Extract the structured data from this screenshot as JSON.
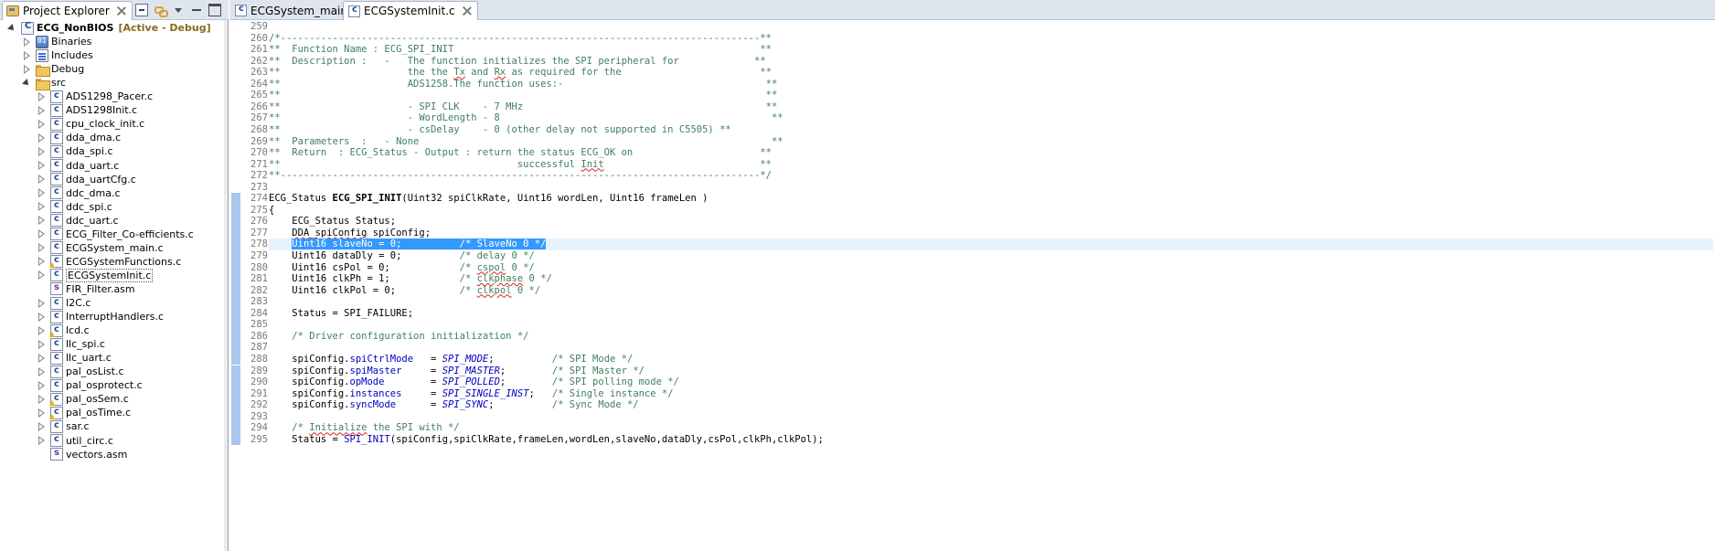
{
  "explorer": {
    "tab_label": "Project Explorer",
    "tree": [
      {
        "label": "ECG_NonBIOS",
        "decoration": "[Active - Debug]",
        "icon": "c-project-icon",
        "level": 0,
        "state": "open",
        "bold": true
      },
      {
        "label": "Binaries",
        "icon": "binaries-icon",
        "level": 1,
        "state": "closed"
      },
      {
        "label": "Includes",
        "icon": "includes-icon",
        "level": 1,
        "state": "closed"
      },
      {
        "label": "Debug",
        "icon": "folder-icon",
        "level": 1,
        "state": "closed"
      },
      {
        "label": "src",
        "icon": "source-folder-icon",
        "level": 1,
        "state": "open"
      },
      {
        "label": "ADS1298_Pacer.c",
        "icon": "c-file-icon",
        "level": 2,
        "state": "closed"
      },
      {
        "label": "ADS1298Init.c",
        "icon": "c-file-icon",
        "level": 2,
        "state": "closed"
      },
      {
        "label": "cpu_clock_init.c",
        "icon": "c-file-icon",
        "level": 2,
        "state": "closed"
      },
      {
        "label": "dda_dma.c",
        "icon": "c-file-icon",
        "level": 2,
        "state": "closed"
      },
      {
        "label": "dda_spi.c",
        "icon": "c-file-icon",
        "level": 2,
        "state": "closed"
      },
      {
        "label": "dda_uart.c",
        "icon": "c-file-icon",
        "level": 2,
        "state": "closed"
      },
      {
        "label": "dda_uartCfg.c",
        "icon": "c-file-icon",
        "level": 2,
        "state": "closed"
      },
      {
        "label": "ddc_dma.c",
        "icon": "c-file-icon",
        "level": 2,
        "state": "closed"
      },
      {
        "label": "ddc_spi.c",
        "icon": "c-file-icon",
        "level": 2,
        "state": "closed"
      },
      {
        "label": "ddc_uart.c",
        "icon": "c-file-icon",
        "level": 2,
        "state": "closed"
      },
      {
        "label": "ECG_Filter_Co-efficients.c",
        "icon": "c-file-icon",
        "level": 2,
        "state": "closed"
      },
      {
        "label": "ECGSystem_main.c",
        "icon": "c-file-icon",
        "level": 2,
        "state": "closed"
      },
      {
        "label": "ECGSystemFunctions.c",
        "icon": "c-file-warning-icon",
        "level": 2,
        "state": "closed"
      },
      {
        "label": "ECGSystemInit.c",
        "icon": "c-file-icon",
        "level": 2,
        "state": "closed",
        "selected": true
      },
      {
        "label": "FIR_Filter.asm",
        "icon": "asm-file-icon",
        "level": 2,
        "state": "none"
      },
      {
        "label": "I2C.c",
        "icon": "c-file-icon",
        "level": 2,
        "state": "closed"
      },
      {
        "label": "InterruptHandlers.c",
        "icon": "c-file-icon",
        "level": 2,
        "state": "closed"
      },
      {
        "label": "lcd.c",
        "icon": "c-file-warning-icon",
        "level": 2,
        "state": "closed"
      },
      {
        "label": "llc_spi.c",
        "icon": "c-file-icon",
        "level": 2,
        "state": "closed"
      },
      {
        "label": "llc_uart.c",
        "icon": "c-file-icon",
        "level": 2,
        "state": "closed"
      },
      {
        "label": "pal_osList.c",
        "icon": "c-file-icon",
        "level": 2,
        "state": "closed"
      },
      {
        "label": "pal_osprotect.c",
        "icon": "c-file-icon",
        "level": 2,
        "state": "closed"
      },
      {
        "label": "pal_osSem.c",
        "icon": "c-file-warning-icon",
        "level": 2,
        "state": "closed"
      },
      {
        "label": "pal_osTime.c",
        "icon": "c-file-warning-icon",
        "level": 2,
        "state": "closed"
      },
      {
        "label": "sar.c",
        "icon": "c-file-icon",
        "level": 2,
        "state": "closed"
      },
      {
        "label": "util_circ.c",
        "icon": "c-file-icon",
        "level": 2,
        "state": "closed"
      },
      {
        "label": "vectors.asm",
        "icon": "asm-file-icon",
        "level": 2,
        "state": "none"
      }
    ]
  },
  "editor": {
    "tabs": [
      {
        "label": "ECGSystem_main.c",
        "active": false
      },
      {
        "label": "ECGSystemInit.c",
        "active": true
      }
    ],
    "current_line": 278,
    "lines": [
      {
        "n": "259",
        "segs": []
      },
      {
        "n": "260",
        "segs": [
          {
            "t": "/*-----------------------------------------------------------------------------------**",
            "c": "cm"
          }
        ]
      },
      {
        "n": "261",
        "segs": [
          {
            "t": "**  Function Name : ECG_SPI_INIT                                                     **",
            "c": "cm"
          }
        ]
      },
      {
        "n": "262",
        "segs": [
          {
            "t": "**  Description :   -   The function initializes the SPI peripheral for             **",
            "c": "cm"
          }
        ]
      },
      {
        "n": "263",
        "segs": [
          {
            "t": "**                      the the ",
            "c": "cm"
          },
          {
            "t": "Tx",
            "c": "cm sq"
          },
          {
            "t": " and ",
            "c": "cm"
          },
          {
            "t": "Rx",
            "c": "cm sq"
          },
          {
            "t": " as required for the                        **",
            "c": "cm"
          }
        ]
      },
      {
        "n": "264",
        "segs": [
          {
            "t": "**                      ADS1258.The function uses:-                                   **",
            "c": "cm"
          }
        ]
      },
      {
        "n": "265",
        "segs": [
          {
            "t": "**                                                                                    **",
            "c": "cm"
          }
        ]
      },
      {
        "n": "266",
        "segs": [
          {
            "t": "**                      - SPI CLK    - 7 MHz                                          **",
            "c": "cm"
          }
        ]
      },
      {
        "n": "267",
        "segs": [
          {
            "t": "**                      - WordLength - 8                                               **",
            "c": "cm"
          }
        ]
      },
      {
        "n": "268",
        "segs": [
          {
            "t": "**                      - csDelay    - 0 (other delay not supported in C5505) **",
            "c": "cm"
          }
        ]
      },
      {
        "n": "269",
        "segs": [
          {
            "t": "**  Parameters  :   - None                                                             **",
            "c": "cm"
          }
        ]
      },
      {
        "n": "270",
        "segs": [
          {
            "t": "**  Return  : ECG_Status - Output : return the status ECG_OK on                      **",
            "c": "cm"
          }
        ]
      },
      {
        "n": "271",
        "segs": [
          {
            "t": "**                                         successful ",
            "c": "cm"
          },
          {
            "t": "Init",
            "c": "cm sq"
          },
          {
            "t": "                           **",
            "c": "cm"
          }
        ]
      },
      {
        "n": "272",
        "segs": [
          {
            "t": "**-----------------------------------------------------------------------------------*/",
            "c": "cm"
          }
        ]
      },
      {
        "n": "273",
        "segs": []
      },
      {
        "n": "274",
        "segs": [
          {
            "t": "ECG_Status ",
            "c": ""
          },
          {
            "t": "ECG_SPI_INIT",
            "c": "kw"
          },
          {
            "t": "(Uint32 spiClkRate, Uint16 wordLen, Uint16 frameLen )",
            "c": ""
          }
        ]
      },
      {
        "n": "275",
        "segs": [
          {
            "t": "{",
            "c": ""
          }
        ]
      },
      {
        "n": "276",
        "segs": [
          {
            "t": "    ECG_Status Status;",
            "c": ""
          }
        ]
      },
      {
        "n": "277",
        "segs": [
          {
            "t": "    ",
            "c": ""
          },
          {
            "t": "DDA_spiConfig",
            "c": "sq"
          },
          {
            "t": " spiConfig;",
            "c": ""
          }
        ]
      },
      {
        "n": "278",
        "segs": [
          {
            "t": "    ",
            "c": ""
          },
          {
            "t": "Uint16 slaveNo = 0;          /* SlaveNo 0 */",
            "c": "sel"
          }
        ]
      },
      {
        "n": "279",
        "segs": [
          {
            "t": "    Uint16 dataDly = 0;          ",
            "c": ""
          },
          {
            "t": "/* delay 0 */",
            "c": "cm"
          }
        ]
      },
      {
        "n": "280",
        "segs": [
          {
            "t": "    Uint16 csPol = 0;            ",
            "c": ""
          },
          {
            "t": "/* ",
            "c": "cm"
          },
          {
            "t": "cspol",
            "c": "cm sq"
          },
          {
            "t": " 0 */",
            "c": "cm"
          }
        ]
      },
      {
        "n": "281",
        "segs": [
          {
            "t": "    Uint16 clkPh = 1;            ",
            "c": ""
          },
          {
            "t": "/* ",
            "c": "cm"
          },
          {
            "t": "clkphase",
            "c": "cm sq"
          },
          {
            "t": " 0 */",
            "c": "cm"
          }
        ]
      },
      {
        "n": "282",
        "segs": [
          {
            "t": "    Uint16 clkPol = 0;           ",
            "c": ""
          },
          {
            "t": "/* ",
            "c": "cm"
          },
          {
            "t": "clkpol",
            "c": "cm sq"
          },
          {
            "t": " 0 */",
            "c": "cm"
          }
        ]
      },
      {
        "n": "283",
        "segs": []
      },
      {
        "n": "284",
        "segs": [
          {
            "t": "    Status = SPI_FAILURE;",
            "c": ""
          }
        ]
      },
      {
        "n": "285",
        "segs": []
      },
      {
        "n": "286",
        "segs": [
          {
            "t": "    /* Driver configuration initialization */",
            "c": "cm"
          }
        ]
      },
      {
        "n": "287",
        "segs": []
      },
      {
        "n": "288",
        "segs": [
          {
            "t": "    spiConfig.",
            "c": ""
          },
          {
            "t": "spiCtrlMode",
            "c": "fld"
          },
          {
            "t": "   = ",
            "c": ""
          },
          {
            "t": "SPI_MODE",
            "c": "mac"
          },
          {
            "t": ";          ",
            "c": ""
          },
          {
            "t": "/* SPI Mode */",
            "c": "cm"
          }
        ]
      },
      {
        "n": "289",
        "segs": [
          {
            "t": "    spiConfig.",
            "c": ""
          },
          {
            "t": "spiMaster",
            "c": "fld"
          },
          {
            "t": "     = ",
            "c": ""
          },
          {
            "t": "SPI_MASTER",
            "c": "mac"
          },
          {
            "t": ";        ",
            "c": ""
          },
          {
            "t": "/* SPI Master */",
            "c": "cm"
          }
        ]
      },
      {
        "n": "290",
        "segs": [
          {
            "t": "    spiConfig.",
            "c": ""
          },
          {
            "t": "opMode",
            "c": "fld"
          },
          {
            "t": "        = ",
            "c": ""
          },
          {
            "t": "SPI_POLLED",
            "c": "mac"
          },
          {
            "t": ";        ",
            "c": ""
          },
          {
            "t": "/* SPI polling mode */",
            "c": "cm"
          }
        ]
      },
      {
        "n": "291",
        "segs": [
          {
            "t": "    spiConfig.",
            "c": ""
          },
          {
            "t": "instances",
            "c": "fld"
          },
          {
            "t": "     = ",
            "c": ""
          },
          {
            "t": "SPI_SINGLE_INST",
            "c": "mac"
          },
          {
            "t": ";   ",
            "c": ""
          },
          {
            "t": "/* Single instance */",
            "c": "cm"
          }
        ]
      },
      {
        "n": "292",
        "segs": [
          {
            "t": "    spiConfig.",
            "c": ""
          },
          {
            "t": "syncMode",
            "c": "fld"
          },
          {
            "t": "      = ",
            "c": ""
          },
          {
            "t": "SPI_SYNC",
            "c": "mac"
          },
          {
            "t": ";          ",
            "c": ""
          },
          {
            "t": "/* Sync Mode */",
            "c": "cm"
          }
        ]
      },
      {
        "n": "293",
        "segs": []
      },
      {
        "n": "294",
        "segs": [
          {
            "t": "    /* ",
            "c": "cm"
          },
          {
            "t": "Initialize",
            "c": "cm sq"
          },
          {
            "t": " the SPI with */",
            "c": "cm"
          }
        ]
      },
      {
        "n": "295",
        "segs": [
          {
            "t": "    Status = ",
            "c": ""
          },
          {
            "t": "SPI_INIT",
            "c": "fld"
          },
          {
            "t": "(spiConfig,spiClkRate,frameLen,wordLen,slaveNo,dataDly,csPol,clkPh,clkPol);",
            "c": ""
          }
        ]
      }
    ]
  }
}
